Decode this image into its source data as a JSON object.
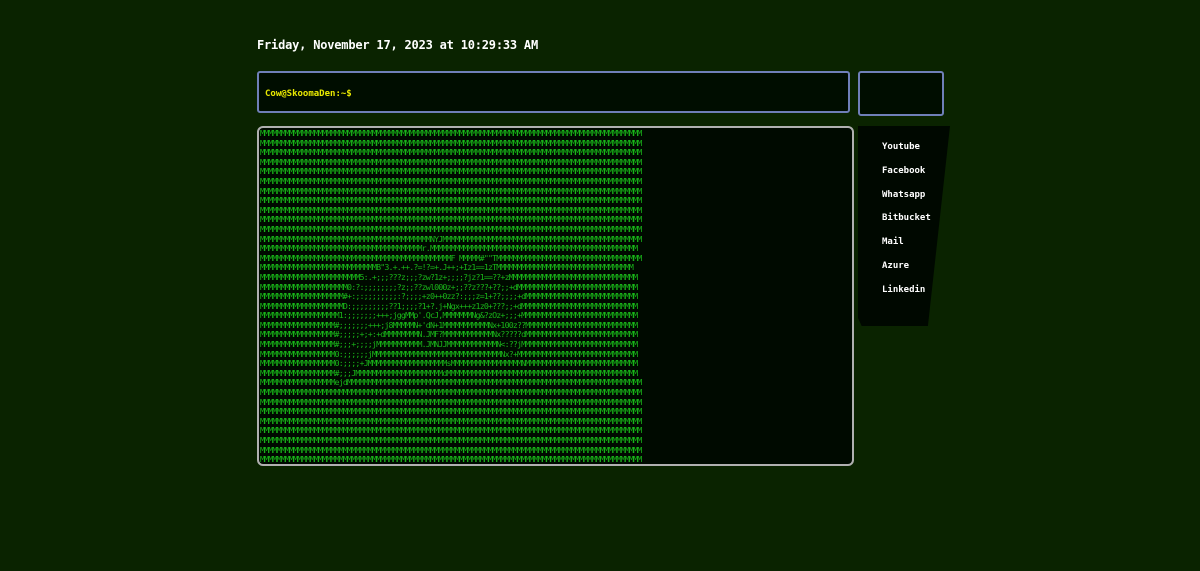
{
  "header": {
    "datetime": "Friday, November 17, 2023 at 10:29:33 AM"
  },
  "terminal": {
    "prompt": "Cow@SkoomaDen:~$"
  },
  "art": {
    "lines": [
      "MMMMMMMMMMMMMMMMMMMMMMMMMMMMMMMMMMMMMMMMMMMMMMMMMMMMMMMMMMMMMMMMMMMMMMMMMMMMMMMMMMMMMMMMMMMM",
      "MMMMMMMMMMMMMMMMMMMMMMMMMMMMMMMMMMMMMMMMMMMMMMMMMMMMMMMMMMMMMMMMMMMMMMMMMMMMMMMMMMMMMMMMMMMM",
      "MMMMMMMMMMMMMMMMMMMMMMMMMMMMMMMMMMMMMMMMMMMMMMMMMMMMMMMMMMMMMMMMMMMMMMMMMMMMMMMMMMMMMMMMMMMM",
      "MMMMMMMMMMMMMMMMMMMMMMMMMMMMMMMMMMMMMMMMMMMMMMMMMMMMMMMMMMMMMMMMMMMMMMMMMMMMMMMMMMMMMMMMMMMM",
      "MMMMMMMMMMMMMMMMMMMMMMMMMMMMMMMMMMMMMMMMMMMMMMMMMMMMMMMMMMMMMMMMMMMMMMMMMMMMMMMMMMMMMMMMMMMM",
      "MMMMMMMMMMMMMMMMMMMMMMMMMMMMMMMMMMMMMMMMMMMMMMMMMMMMMMMMMMMMMMMMMMMMMMMMMMMMMMMMMMMMMMMMMMMM",
      "MMMMMMMMMMMMMMMMMMMMMMMMMMMMMMMMMMMMMMMMMMMMMMMMMMMMMMMMMMMMMMMMMMMMMMMMMMMMMMMMMMMMMMMMMMMM",
      "MMMMMMMMMMMMMMMMMMMMMMMMMMMMMMMMMMMMMMMMMMMMMMMMMMMMMMMMMMMMMMMMMMMMMMMMMMMMMMMMMMMMMMMMMMMM",
      "MMMMMMMMMMMMMMMMMMMMMMMMMMMMMMMMMMMMMMMMMMMMMMMMMMMMMMMMMMMMMMMMMMMMMMMMMMMMMMMMMMMMMMMMMMMM",
      "MMMMMMMMMMMMMMMMMMMMMMMMMMMMMMMMMMMMMMMMMMMMMMMMMMMMMMMMMMMMMMMMMMMMMMMMMMMMMMMMMMMMMMMMMMMM",
      "MMMMMMMMMMMMMMMMMMMMMMMMMMMMMMMMMMMMMMMMMMMMMMMMMMMMMMMMMMMMMMMMMMMMMMMMMMMMMMMMMMMMMMMMMMMM",
      "MMMMMMMMMMMMMMMMMMMMMMMMMMMMMMMMMMMMMMMMMNYJMMMMMMMMMMMMMMMMMMMMMMMMMMMMMMMMMMMMMMMMMMMMMMMM",
      "MMMMMMMMMMMMMMMMMMMMMMMMMMMMMMMMMMMMMMMr.MMMMMMMMMMMMMMMMMMMMMMMMMMMMMMMMMMMMMMMMMMMMMMMMMM",
      "MMMMMMMMMMMMMMMMMMMMMMMMMMMMMMMMMMMMMMMMMMMMMMF MMMMM#\"\"TMMMMMMMMMMMMMMMMMMMMMMMMMMMMMMMMMMM",
      "MMMMMMMMMMMMMMMMMMMMMMMMMMMMB\"3.+.++.?=!?=+.J++;+Iz1==1zTMMMMMMMMMMMMMMMMMMMMMMMMMMMMMMMMM",
      "MMMMMMMMMMMMMMMMMMMMMMMM5:.+;;;???z;;;?zw?1z+;;;;?jz?1==??+zMMMMMMMMMMMMMMMMMMMMMMMMMMMMMMM",
      "MMMMMMMMMMMMMMMMMMMMM0:?:;;;;;;;;?z;;??zwl000z+;;??z???+??;;+dMMMMMMMMMMMMMMMMMMMMMMMMMMMMM",
      "MMMMMMMMMMMMMMMMMMMM#+:;:;;;;;;;;:?;;;;+z0++0zz?:;;;z=1+??;;;;+dMMMMMMMMMMMMMMMMMMMMMMMMMMM",
      "MMMMMMMMMMMMMMMMMMMMD:;;;;;;;;;??1;;;;?1+?.j+Ngx+++z1z0+???;;+dMMMMMMMMMMMMMMMMMMMMMMMMMMMM",
      "MMMMMMMMMMMMMMMMMMM1:;;;;;;;+++;jggMMp'.QcJ,MMMMMMMNg&?zOz+;;;+MMMMMMMMMMMMMMMMMMMMMMMMMMMM",
      "MMMMMMMMMMMMMMMMMM#;;;;;;;+++;j8MMMMMN+'dN+1MMMMMMMMMMMNx+100z??MMMMMMMMMMMMMMMMMMMMMMMMMMM",
      "MMMMMMMMMMMMMMMMMM#;;;;;+;+:+dMMMMMMMMN.JMF?MMMMMMMMMMMMNx?????dMMMMMMMMMMMMMMMMMMMMMMMMMMM",
      "MMMMMMMMMMMMMMMMMM#;;;+;;;;jMMMMMMMMMMM.JMNJJMMMMMMMMMMMMN<:??jMMMMMMMMMMMMMMMMMMMMMMMMMMMM",
      "MMMMMMMMMMMMMMMMMM0:;;;;;;jMMMMMMMMMMMMMMMMMMMMMMMMMMMMMMMNx?+MMMMMMMMMMMMMMMMMMMMMMMMMMMMM",
      "MMMMMMMMMMMMMMMMMM0:;;;;+JMMMMMMMMMMMMMMMMMMMsMMMMMMMMMMMMMMMMMNMMMMMMMMMMMMMMMMMMMMMMMMMMM",
      "MMMMMMMMMMMMMMMMMM#;;;JMMMMMMMMMMMMMMMMMMMMMdMMMMMMMMMMMMMMMMMMMMMMMMMMMMMMMMMMMMMMMMMMMMMM",
      "MMMMMMMMMMMMMMMMMMejdMMMMMMMMMMMMMMMMMMMMMMMMMMMMMMMMMMMMMMMMMMMMMMMMMMMMMMMMMMMMMMMMMMMMMMM",
      "MMMMMMMMMMMMMMMMMMMMMMMMMMMMMMMMMMMMMMMMMMMMMMMMMMMMMMMMMMMMMMMMMMMMMMMMMMMMMMMMMMMMMMMMMMMM",
      "MMMMMMMMMMMMMMMMMMMMMMMMMMMMMMMMMMMMMMMMMMMMMMMMMMMMMMMMMMMMMMMMMMMMMMMMMMMMMMMMMMMMMMMMMMMM",
      "MMMMMMMMMMMMMMMMMMMMMMMMMMMMMMMMMMMMMMMMMMMMMMMMMMMMMMMMMMMMMMMMMMMMMMMMMMMMMMMMMMMMMMMMMMMM",
      "MMMMMMMMMMMMMMMMMMMMMMMMMMMMMMMMMMMMMMMMMMMMMMMMMMMMMMMMMMMMMMMMMMMMMMMMMMMMMMMMMMMMMMMMMMMM",
      "MMMMMMMMMMMMMMMMMMMMMMMMMMMMMMMMMMMMMMMMMMMMMMMMMMMMMMMMMMMMMMMMMMMMMMMMMMMMMMMMMMMMMMMMMMMM",
      "MMMMMMMMMMMMMMMMMMMMMMMMMMMMMMMMMMMMMMMMMMMMMMMMMMMMMMMMMMMMMMMMMMMMMMMMMMMMMMMMMMMMMMMMMMMM",
      "MMMMMMMMMMMMMMMMMMMMMMMMMMMMMMMMMMMMMMMMMMMMMMMMMMMMMMMMMMMMMMMMMMMMMMMMMMMMMMMMMMMMMMMMMMMM",
      "MMMMMMMMMMMMMMMMMMMMMMMMMMMMMMMMMMMMMMMMMMMMMMMMMMMMMMMMMMMMMMMMMMMMMMMMMMMMMMMMMMMMMMMMMMMM"
    ]
  },
  "links": [
    {
      "label": "Youtube"
    },
    {
      "label": "Facebook"
    },
    {
      "label": "Whatsapp"
    },
    {
      "label": "Bitbucket"
    },
    {
      "label": "Mail"
    },
    {
      "label": "Azure"
    },
    {
      "label": "Linkedin"
    }
  ],
  "colors": {
    "background": "#0a2300",
    "prompt": "#e9e900",
    "ascii": "#19b519",
    "border": "#6f7fb8"
  }
}
